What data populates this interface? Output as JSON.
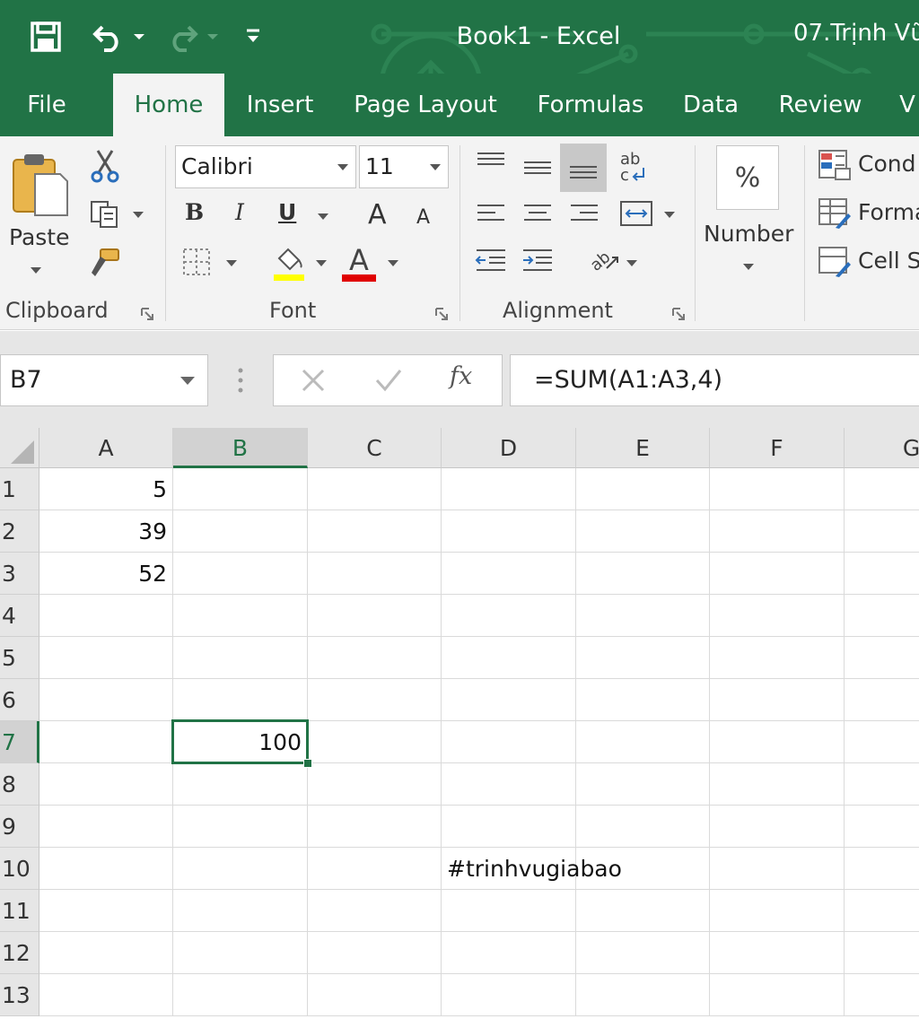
{
  "app": {
    "document_title": "Book1  -  Excel",
    "user_name": "07.Trịnh Vũ"
  },
  "colors": {
    "brand": "#217346",
    "ribbon_bg": "#f3f3f3",
    "highlight_yellow": "#ffff00",
    "font_red": "#ff0000"
  },
  "tabs": [
    {
      "label": "File",
      "active": false
    },
    {
      "label": "Home",
      "active": true
    },
    {
      "label": "Insert",
      "active": false
    },
    {
      "label": "Page Layout",
      "active": false
    },
    {
      "label": "Formulas",
      "active": false
    },
    {
      "label": "Data",
      "active": false
    },
    {
      "label": "Review",
      "active": false
    },
    {
      "label": "V",
      "active": false
    }
  ],
  "ribbon": {
    "clipboard": {
      "paste_label": "Paste",
      "group_label": "Clipboard"
    },
    "font": {
      "font_name": "Calibri",
      "font_size": "11",
      "group_label": "Font",
      "bold": "B",
      "italic": "I",
      "underline": "U",
      "grow": "A",
      "shrink": "A",
      "font_color_glyph": "A"
    },
    "alignment": {
      "group_label": "Alignment",
      "wrap_glyph": "ab"
    },
    "number": {
      "percent": "%",
      "label": "Number"
    },
    "styles": {
      "conditional": "Cond",
      "format_table": "Forma",
      "cell_styles": "Cell S"
    }
  },
  "formula_bar": {
    "name_box": "B7",
    "fx": "fx",
    "formula": "=SUM(A1:A3,4)"
  },
  "grid": {
    "columns": [
      "A",
      "B",
      "C",
      "D",
      "E",
      "F",
      "G"
    ],
    "selected_column": "B",
    "rows": [
      "1",
      "2",
      "3",
      "4",
      "5",
      "6",
      "7",
      "8",
      "9",
      "10",
      "11",
      "12",
      "13"
    ],
    "selected_row": "7",
    "active_cell": "B7",
    "cells": {
      "A1": "5",
      "A2": "39",
      "A3": "52",
      "B7": "100",
      "D10": "#trinhvugiabao"
    }
  }
}
